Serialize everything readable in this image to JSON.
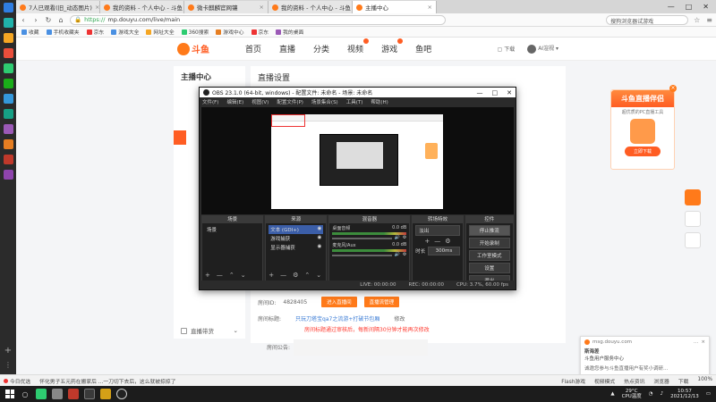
{
  "tabs": [
    {
      "label": "7人已观看(旧_动态图片)"
    },
    {
      "label": "我的资料 - 个人中心 - 斗鱼"
    },
    {
      "label": "微卡麒麟官网镶"
    },
    {
      "label": "我的资料 - 个人中心 - 斗鱼"
    },
    {
      "label": "主播中心"
    }
  ],
  "address": {
    "https": "https://",
    "host": "mp.douyu.com/live/main",
    "search_placeholder": "搜狗浏览器试游戏"
  },
  "bookmarks": [
    {
      "label": "收藏"
    },
    {
      "label": "手机收藏夹"
    },
    {
      "label": "京东"
    },
    {
      "label": "游戏大全"
    },
    {
      "label": "网址大全"
    },
    {
      "label": "360搜索"
    },
    {
      "label": "游戏中心"
    },
    {
      "label": "京东"
    },
    {
      "label": "我的桌面"
    }
  ],
  "site": {
    "logo": "斗鱼",
    "nav": [
      "首页",
      "直播",
      "分类",
      "视频",
      "游戏",
      "鱼吧"
    ],
    "download": "下载",
    "username": "AI渲视"
  },
  "sidebar": {
    "title": "主播中心",
    "last_item": "直播带货"
  },
  "main": {
    "title": "直播设置",
    "room_id_label": "房间ID:",
    "room_id": "4828405",
    "enter_btn": "进入直播间",
    "manage_btn": "直播流管理",
    "room_title_label": "房间标题:",
    "room_title": "只玩刀塔宝qa7之流游+打破节包厢",
    "modify": "修改",
    "tip": "房间标题通过审核后，每新间隔30分钟才能再次修改",
    "notice_label": "房间公告:"
  },
  "ad": {
    "title": "斗鱼直播伴侣",
    "subtitle": "超优质的PC直播工具",
    "button": "立即下载"
  },
  "notif": {
    "source": "msg.douyu.com",
    "title": "斯海差",
    "sub": "斗鱼用户服务中心",
    "body": "诚邀您参与斗鱼直播用户有奖小调研…"
  },
  "obs": {
    "title": "OBS 23.1.0 (64-bit, windows) - 配置文件: 未命名 - 场景: 未命名",
    "menu": [
      "文件(F)",
      "编辑(E)",
      "视图(V)",
      "配置文件(P)",
      "场景集合(S)",
      "工具(T)",
      "帮助(H)"
    ],
    "docks": {
      "scenes": "场景",
      "sources": "来源",
      "mixer": "混音器",
      "transitions": "转场特效",
      "controls": "控件"
    },
    "scene_item": "场景",
    "sources": [
      "文本 (GDI+)",
      "游戏捕获",
      "显示器捕获"
    ],
    "mixer": [
      {
        "name": "桌面音频",
        "db": "0.0 dB"
      },
      {
        "name": "麦克风/Aux",
        "db": "0.0 dB"
      }
    ],
    "transition": "淡出",
    "duration_label": "时长",
    "duration": "300ms",
    "controls": [
      "停止推流",
      "开始录制",
      "工作室模式",
      "设置",
      "退出"
    ],
    "status": {
      "live": "LIVE: 00:00:00",
      "rec": "REC: 00:00:00",
      "cpu": "CPU: 3.7%, 60.00 fps"
    }
  },
  "statusline": {
    "left": "今日优选",
    "news": [
      "怀化男子五元药在搬家后 ...一刀切下去后，这么就被掠掠了"
    ],
    "right": [
      "Flash游戏",
      "视频模式",
      "热点资讯",
      "浏览器",
      "下载",
      "100%"
    ]
  },
  "tray": {
    "temp": "29°C",
    "temp_label": "CPU温度",
    "time": "10:57",
    "date": "2021/12/13"
  },
  "colors": {
    "brand": "#ff5d23",
    "accent": "#ff7a1a",
    "obs_dark": "#2b2b2b"
  }
}
